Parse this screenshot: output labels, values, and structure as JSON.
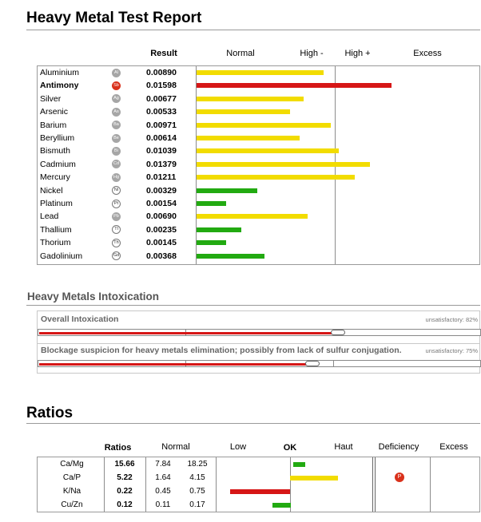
{
  "report": {
    "title": "Heavy Metal Test Report"
  },
  "metal_table": {
    "headers": {
      "result": "Result",
      "normal": "Normal",
      "high_minus": "High -",
      "high_plus": "High +",
      "excess": "Excess"
    },
    "rows": [
      {
        "name": "Aluminium",
        "symbol": "Al",
        "result": "0.00890",
        "level": 0.65,
        "color": "#f2dc00",
        "badge": "grey",
        "bold": false
      },
      {
        "name": "Antimony",
        "symbol": "Sb",
        "result": "0.01598",
        "level": 1.0,
        "color": "#d61616",
        "badge": "red",
        "bold": true
      },
      {
        "name": "Silver",
        "symbol": "Ag",
        "result": "0.00677",
        "level": 0.55,
        "color": "#f2dc00",
        "badge": "grey",
        "bold": false
      },
      {
        "name": "Arsenic",
        "symbol": "As",
        "result": "0.00533",
        "level": 0.48,
        "color": "#f2dc00",
        "badge": "grey",
        "bold": false
      },
      {
        "name": "Barium",
        "symbol": "Ba",
        "result": "0.00971",
        "level": 0.69,
        "color": "#f2dc00",
        "badge": "grey",
        "bold": false
      },
      {
        "name": "Beryllium",
        "symbol": "Be",
        "result": "0.00614",
        "level": 0.53,
        "color": "#f2dc00",
        "badge": "grey",
        "bold": false
      },
      {
        "name": "Bismuth",
        "symbol": "Bi",
        "result": "0.01039",
        "level": 0.73,
        "color": "#f2dc00",
        "badge": "grey",
        "bold": false
      },
      {
        "name": "Cadmium",
        "symbol": "Cd",
        "result": "0.01379",
        "level": 0.89,
        "color": "#f2dc00",
        "badge": "grey",
        "bold": false
      },
      {
        "name": "Mercury",
        "symbol": "Hg",
        "result": "0.01211",
        "level": 0.81,
        "color": "#f2dc00",
        "badge": "grey",
        "bold": false
      },
      {
        "name": "Nickel",
        "symbol": "Ni",
        "result": "0.00329",
        "level": 0.31,
        "color": "#22aa11",
        "badge": "outline",
        "bold": false
      },
      {
        "name": "Platinum",
        "symbol": "Pt",
        "result": "0.00154",
        "level": 0.15,
        "color": "#22aa11",
        "badge": "outline",
        "bold": false
      },
      {
        "name": "Lead",
        "symbol": "Pb",
        "result": "0.00690",
        "level": 0.57,
        "color": "#f2dc00",
        "badge": "grey",
        "bold": false
      },
      {
        "name": "Thallium",
        "symbol": "Tl",
        "result": "0.00235",
        "level": 0.23,
        "color": "#22aa11",
        "badge": "outline",
        "bold": false
      },
      {
        "name": "Thorium",
        "symbol": "Th",
        "result": "0.00145",
        "level": 0.15,
        "color": "#22aa11",
        "badge": "outline",
        "bold": false
      },
      {
        "name": "Gadolinium",
        "symbol": "Gd",
        "result": "0.00368",
        "level": 0.35,
        "color": "#22aa11",
        "badge": "outline",
        "bold": false
      }
    ]
  },
  "intoxication": {
    "title": "Heavy Metals Intoxication",
    "items": [
      {
        "label": "Overall Intoxication",
        "status": "unsatisfactory: 82%",
        "percent": 82
      },
      {
        "label": "Blockage suspicion for heavy metals elimination; possibly from lack of sulfur conjugation.",
        "status": "unsatisfactory: 75%",
        "percent": 75
      }
    ]
  },
  "ratios": {
    "title": "Ratios",
    "headers": {
      "ratios": "Ratios",
      "normal": "Normal",
      "low": "Low",
      "ok": "OK",
      "haut": "Haut",
      "deficiency": "Deficiency",
      "excess": "Excess"
    },
    "rows": [
      {
        "name": "Ca/Mg",
        "value": "15.66",
        "min": "7.84",
        "max": "18.25",
        "position": 0.05,
        "extent": 0.2,
        "color": "#22aa11",
        "flag": ""
      },
      {
        "name": "Ca/P",
        "value": "5.22",
        "min": "1.64",
        "max": "4.15",
        "position": 0.0,
        "extent": 0.8,
        "color": "#f2dc00",
        "flag": "P"
      },
      {
        "name": "K/Na",
        "value": "0.22",
        "min": "0.45",
        "max": "0.75",
        "position": -1.0,
        "extent": 1.0,
        "color": "#d61616",
        "flag": ""
      },
      {
        "name": "Cu/Zn",
        "value": "0.12",
        "min": "0.11",
        "max": "0.17",
        "position": -0.3,
        "extent": 0.3,
        "color": "#22aa11",
        "flag": ""
      }
    ]
  }
}
